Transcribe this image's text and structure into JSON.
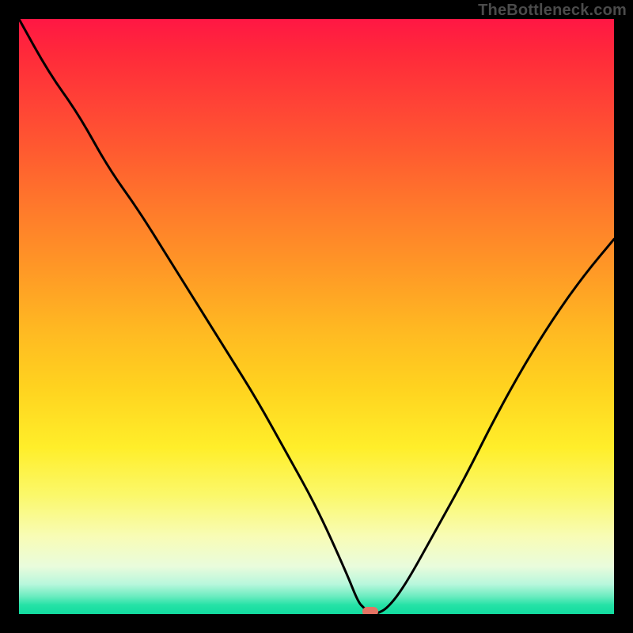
{
  "watermark": "TheBottleneck.com",
  "colors": {
    "frame": "#000000",
    "curve": "#000000",
    "marker": "#e57364",
    "gradient_top": "#ff1744",
    "gradient_mid": "#ffee2a",
    "gradient_bottom": "#12dca0"
  },
  "chart_data": {
    "type": "line",
    "title": "",
    "xlabel": "",
    "ylabel": "",
    "xlim": [
      0,
      100
    ],
    "ylim": [
      0,
      100
    ],
    "grid": false,
    "legend": false,
    "series": [
      {
        "name": "bottleneck-curve",
        "x": [
          0,
          5,
          10,
          15,
          20,
          25,
          30,
          35,
          40,
          45,
          50,
          55,
          57,
          58,
          59,
          60,
          62,
          65,
          70,
          75,
          80,
          85,
          90,
          95,
          100
        ],
        "values": [
          100,
          91,
          84,
          75,
          68,
          60,
          52,
          44,
          36,
          27,
          18,
          7,
          2,
          1,
          0,
          0,
          1,
          5,
          14,
          23,
          33,
          42,
          50,
          57,
          63
        ]
      }
    ],
    "annotations": [
      {
        "name": "min-marker",
        "x": 59,
        "y": 0
      }
    ]
  }
}
